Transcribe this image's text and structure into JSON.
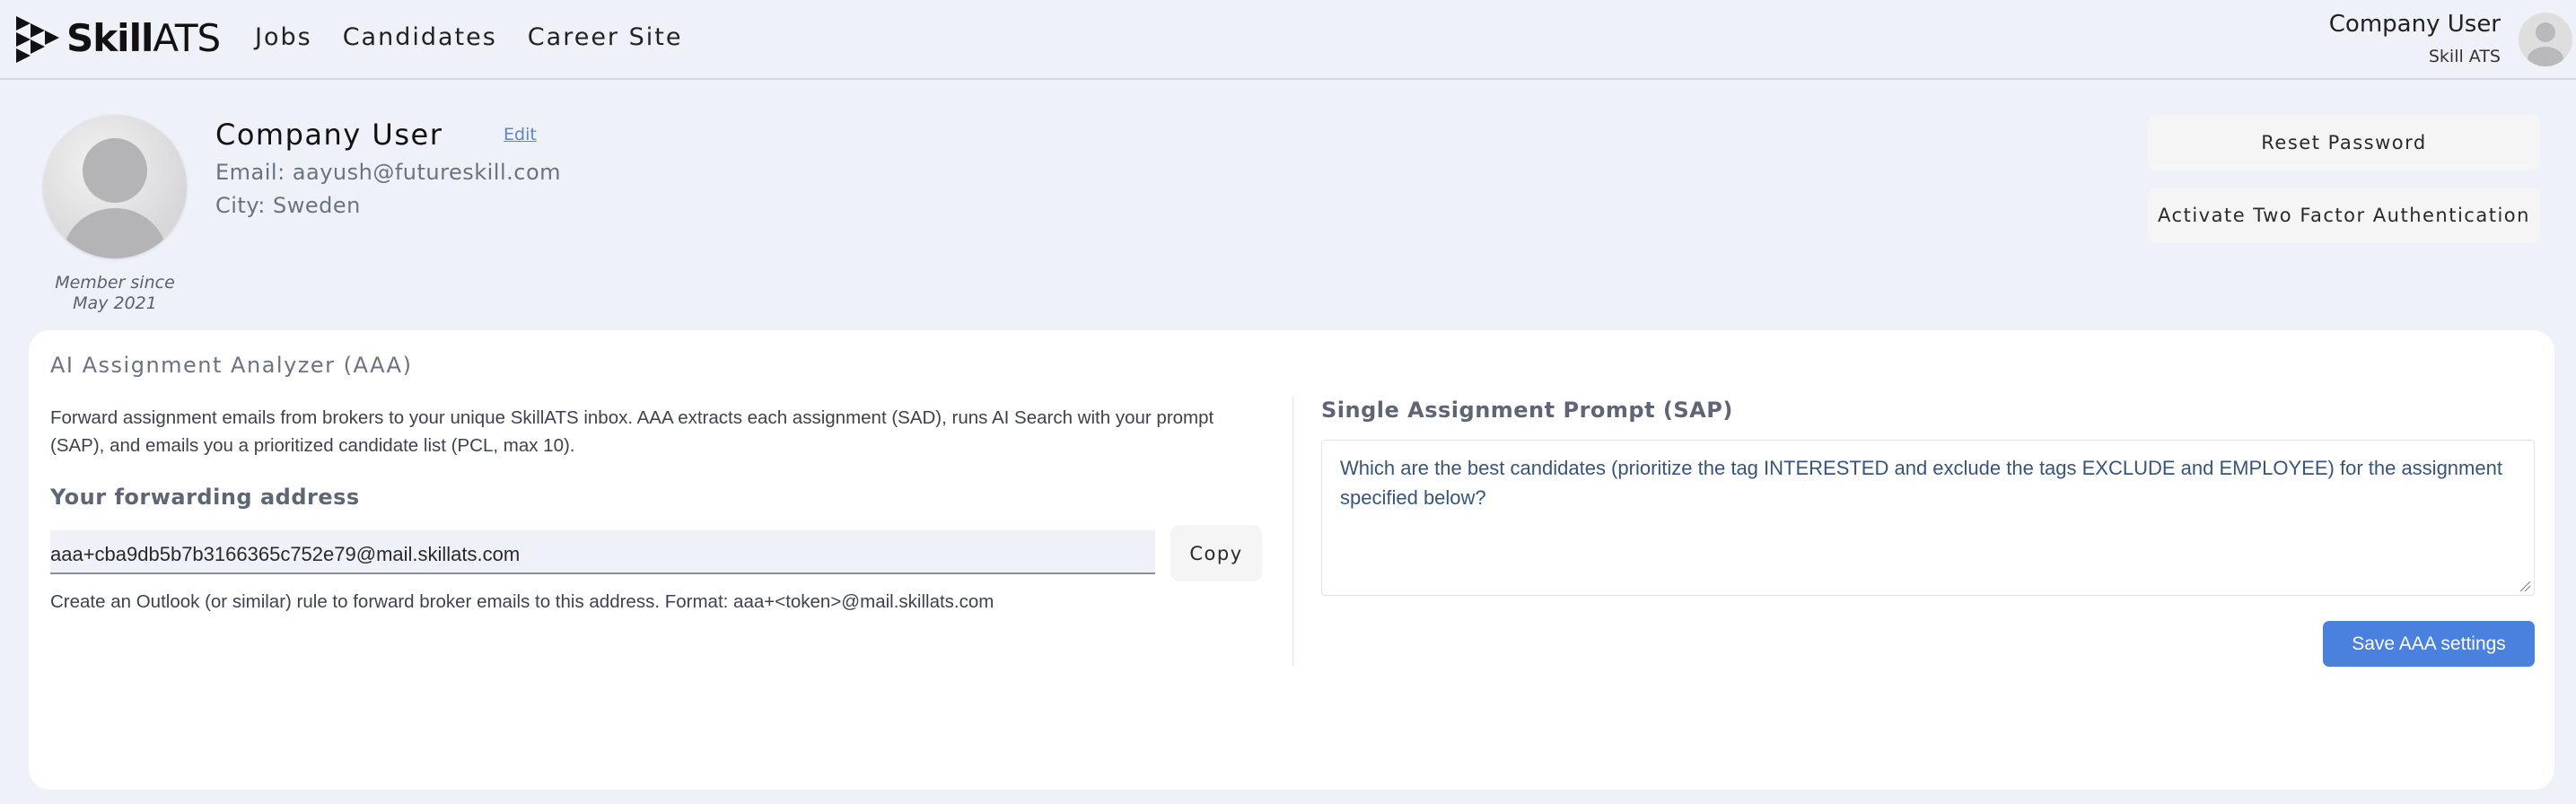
{
  "brand": {
    "name_bold": "Skill",
    "name_light": "ATS",
    "icon": "play-arrows-logo-icon"
  },
  "nav": {
    "items": [
      {
        "label": "Jobs"
      },
      {
        "label": "Candidates"
      },
      {
        "label": "Career Site"
      }
    ]
  },
  "current_user": {
    "name": "Company User",
    "organization": "Skill ATS",
    "avatar_icon": "user-avatar-icon"
  },
  "profile": {
    "name": "Company User",
    "edit_label": "Edit",
    "email": "Email: aayush@futureskill.com",
    "city": "City: Sweden",
    "member_since_line1": "Member since",
    "member_since_line2": "May 2021",
    "avatar_icon": "profile-avatar-icon"
  },
  "actions": {
    "reset_password": "Reset Password",
    "activate_2fa": "Activate Two Factor Authentication"
  },
  "aaa": {
    "title": "AI Assignment Analyzer (AAA)",
    "description": "Forward assignment emails from brokers to your unique SkillATS inbox. AAA extracts each assignment (SAD), runs AI Search with your prompt (SAP), and emails you a prioritized candidate list (PCL, max 10).",
    "forwarding_label": "Your forwarding address",
    "forwarding_address": "aaa+cba9db5b7b3166365c752e79@mail.skillats.com",
    "copy_label": "Copy",
    "forwarding_help": "Create an Outlook (or similar) rule to forward broker emails to this address. Format: aaa+<token>@mail.skillats.com",
    "prompt_label": "Single Assignment Prompt (SAP)",
    "prompt_text": "Which are the best candidates (prioritize the tag INTERESTED and exclude the tags EXCLUDE and EMPLOYEE) for the assignment specified below?",
    "save_label": "Save AAA settings"
  },
  "colors": {
    "background": "#eef1f7",
    "accent": "#4a80de",
    "link": "#5b86d6",
    "prompt_text": "#35557e"
  }
}
